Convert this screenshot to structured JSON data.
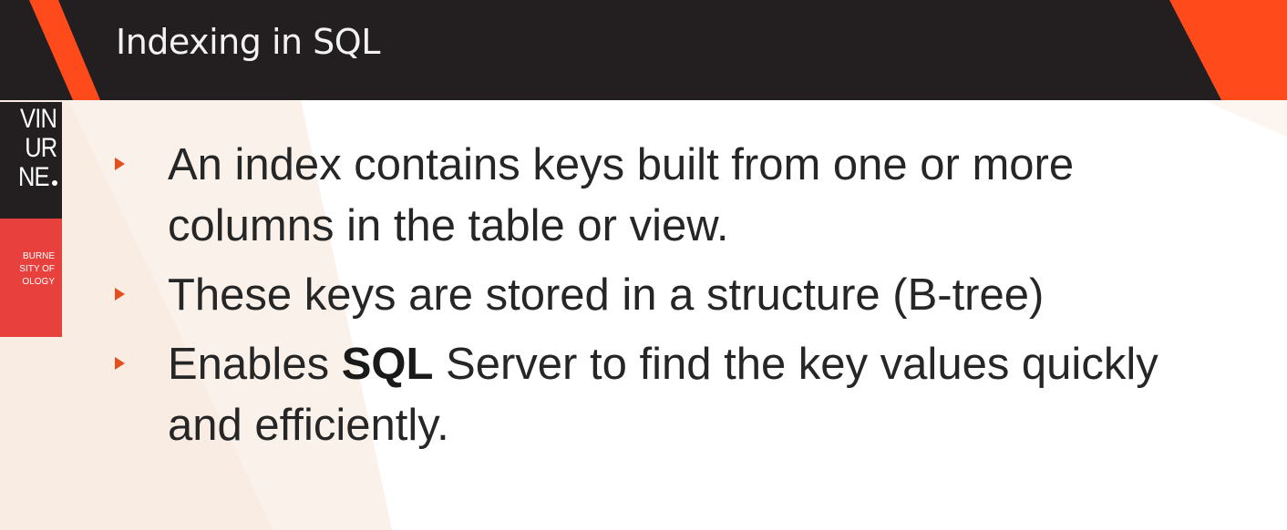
{
  "slide": {
    "title": "Indexing in SQL"
  },
  "logo": {
    "lines": [
      "VIN",
      "UR",
      "NE"
    ],
    "subtitle": [
      "BURNE",
      "SITY OF",
      "OLOGY"
    ]
  },
  "bullets": [
    {
      "text": "An index contains keys built from one or more columns in the table or view."
    },
    {
      "text": "These keys are stored in a structure (B-tree)"
    },
    {
      "text_before": "Enables ",
      "bold": "SQL",
      "text_after": " Server to find the key values quickly and efficiently."
    }
  ],
  "colors": {
    "header_background": "#231f20",
    "accent_orange": "#ff4a1c",
    "bullet_marker": "#e3501f",
    "logo_red": "#e8413d"
  }
}
